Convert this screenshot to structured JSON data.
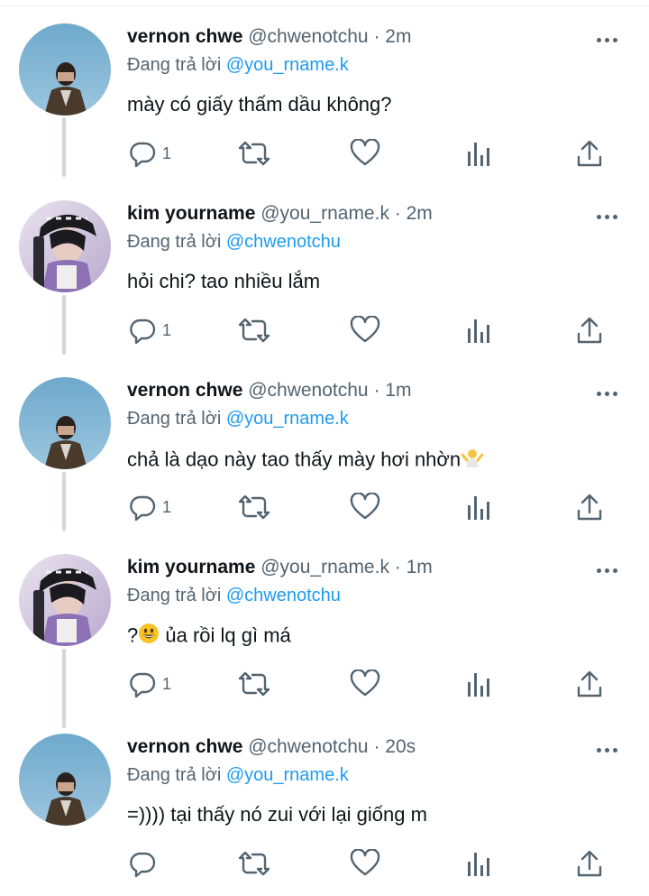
{
  "icons": {
    "reply": "reply-icon",
    "retweet": "retweet-icon",
    "like": "heart-icon",
    "views": "analytics-icon",
    "share": "share-icon",
    "more": "more-icon"
  },
  "colors": {
    "link": "#1d9bf0",
    "secondary_text": "#536471",
    "thread_line": "#cfd9de"
  },
  "replying_prefix": "Đang trả lời",
  "tweets": [
    {
      "name": "vernon chwe",
      "handle": "@chwenotchu",
      "time": "· 2m",
      "reply_to": "@you_rname.k",
      "text": "mày có giấy thấm dầu không?",
      "reply_count": "1"
    },
    {
      "name": "kim yourname",
      "handle": "@you_rname.k",
      "time": "· 2m",
      "reply_to": "@chwenotchu",
      "text": "hỏi chi? tao nhiều lắm",
      "reply_count": "1"
    },
    {
      "name": "vernon chwe",
      "handle": "@chwenotchu",
      "time": "· 1m",
      "reply_to": "@you_rname.k",
      "text": "chả là dạo này tao thấy mày hơi nhờn",
      "reply_count": "1"
    },
    {
      "name": "kim yourname",
      "handle": "@you_rname.k",
      "time": "· 1m",
      "reply_to": "@chwenotchu",
      "text_prefix": "?",
      "text": " ủa rồi lq gì má",
      "reply_count": "1"
    },
    {
      "name": "vernon chwe",
      "handle": "@chwenotchu",
      "time": "· 20s",
      "reply_to": "@you_rname.k",
      "text": "=)))) tại thấy nó zui với lại giống m",
      "reply_count": ""
    }
  ]
}
